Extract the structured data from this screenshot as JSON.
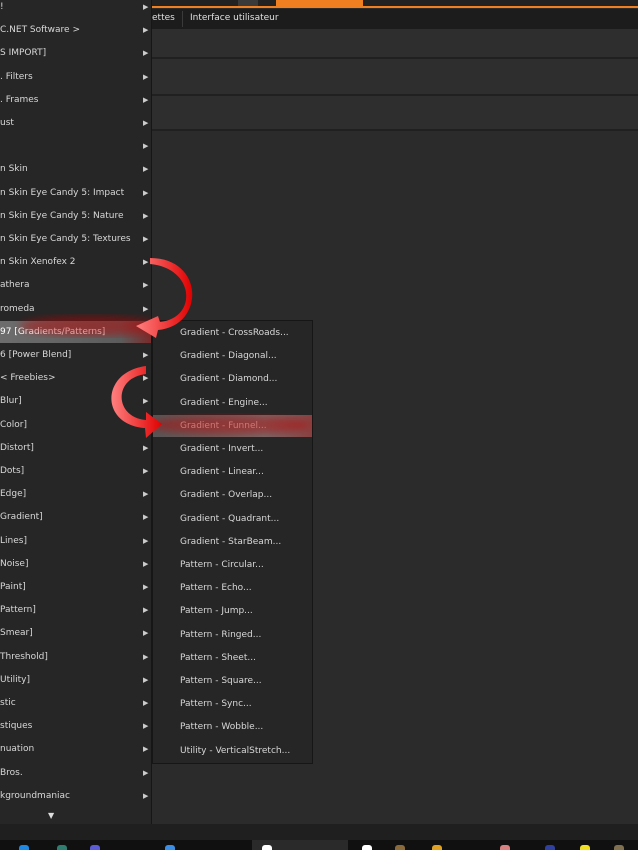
{
  "header": {
    "tabs": [
      {
        "label": "ettes"
      },
      {
        "label": "Interface utilisateur"
      }
    ],
    "accent": "#f07f22"
  },
  "menu": {
    "items": [
      {
        "label": "!"
      },
      {
        "label": "C.NET Software >"
      },
      {
        "label": "S IMPORT]"
      },
      {
        "label": ". Filters"
      },
      {
        "label": ". Frames"
      },
      {
        "label": "ust"
      },
      {
        "label": ""
      },
      {
        "label": "n Skin"
      },
      {
        "label": "n Skin Eye Candy 5: Impact"
      },
      {
        "label": "n Skin Eye Candy 5: Nature"
      },
      {
        "label": "n Skin Eye Candy 5: Textures"
      },
      {
        "label": "n Skin Xenofex 2"
      },
      {
        "label": "athera"
      },
      {
        "label": "romeda"
      },
      {
        "label": "97 [Gradients/Patterns]",
        "highlighted": true
      },
      {
        "label": "6 [Power Blend]"
      },
      {
        "label": "< Freebies>"
      },
      {
        "label": "Blur]"
      },
      {
        "label": "Color]"
      },
      {
        "label": "Distort]"
      },
      {
        "label": "Dots]"
      },
      {
        "label": "Edge]"
      },
      {
        "label": "Gradient]"
      },
      {
        "label": "Lines]"
      },
      {
        "label": "Noise]"
      },
      {
        "label": "Paint]"
      },
      {
        "label": "Pattern]"
      },
      {
        "label": "Smear]"
      },
      {
        "label": "Threshold]"
      },
      {
        "label": "Utility]"
      },
      {
        "label": "stic"
      },
      {
        "label": "stiques"
      },
      {
        "label": "nuation"
      },
      {
        "label": "Bros."
      },
      {
        "label": "kgroundmaniac"
      }
    ]
  },
  "submenu": {
    "items": [
      {
        "label": "Gradient - CrossRoads..."
      },
      {
        "label": "Gradient - Diagonal..."
      },
      {
        "label": "Gradient - Diamond..."
      },
      {
        "label": "Gradient - Engine..."
      },
      {
        "label": "Gradient - Funnel...",
        "highlighted": true
      },
      {
        "label": "Gradient - Invert..."
      },
      {
        "label": "Gradient - Linear..."
      },
      {
        "label": "Gradient - Overlap..."
      },
      {
        "label": "Gradient - Quadrant..."
      },
      {
        "label": "Gradient - StarBeam..."
      },
      {
        "label": "Pattern - Circular..."
      },
      {
        "label": "Pattern - Echo..."
      },
      {
        "label": "Pattern - Jump..."
      },
      {
        "label": "Pattern - Ringed..."
      },
      {
        "label": "Pattern - Sheet..."
      },
      {
        "label": "Pattern - Square..."
      },
      {
        "label": "Pattern - Sync..."
      },
      {
        "label": "Pattern - Wobble..."
      },
      {
        "label": "Utility - VerticalStretch..."
      }
    ]
  }
}
